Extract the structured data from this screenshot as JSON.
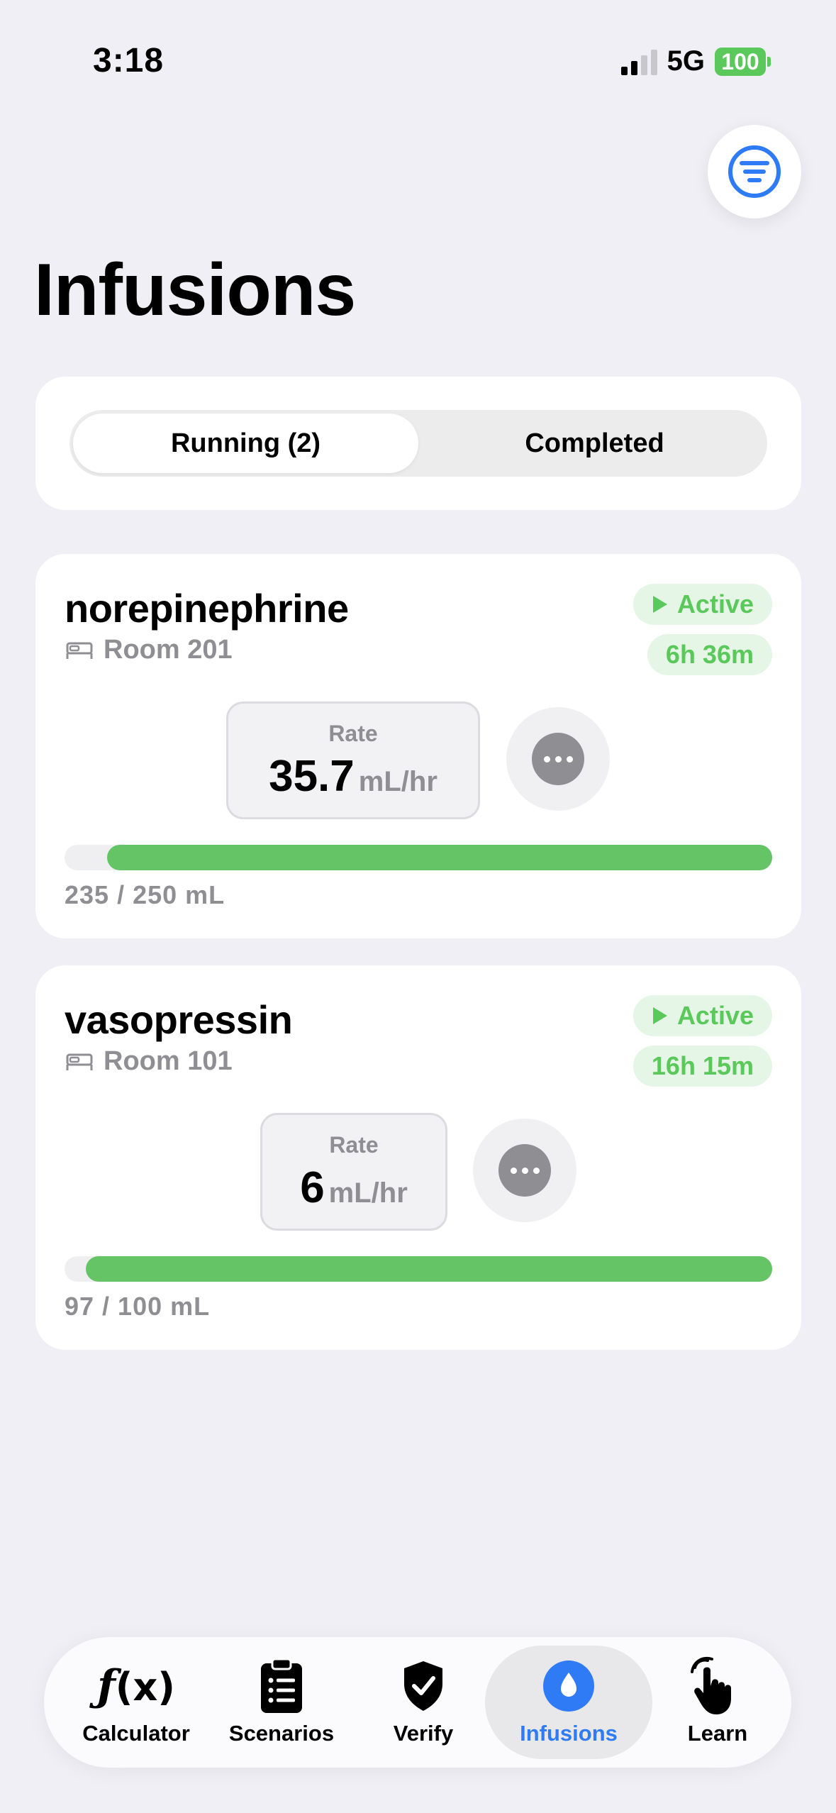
{
  "status_bar": {
    "time": "3:18",
    "network": "5G",
    "battery": "100"
  },
  "page": {
    "title": "Infusions"
  },
  "segments": {
    "running": "Running (2)",
    "completed": "Completed"
  },
  "infusions": [
    {
      "drug": "norepinephrine",
      "room": "Room 201",
      "status": "Active",
      "elapsed": "6h 36m",
      "rate_label": "Rate",
      "rate_value": "35.7",
      "rate_unit": "mL/hr",
      "volume_text": "235 / 250 mL",
      "progress": 0.94
    },
    {
      "drug": "vasopressin",
      "room": "Room 101",
      "status": "Active",
      "elapsed": "16h 15m",
      "rate_label": "Rate",
      "rate_value": "6",
      "rate_unit": "mL/hr",
      "volume_text": "97 / 100 mL",
      "progress": 0.97
    }
  ],
  "tabs": [
    {
      "label": "Calculator",
      "icon": "function-icon"
    },
    {
      "label": "Scenarios",
      "icon": "clipboard-icon"
    },
    {
      "label": "Verify",
      "icon": "shield-check-icon"
    },
    {
      "label": "Infusions",
      "icon": "drop-icon",
      "selected": true
    },
    {
      "label": "Learn",
      "icon": "hand-point-icon"
    }
  ],
  "colors": {
    "accent": "#2f7af5",
    "active_green": "#5ac85a",
    "progress_green": "#65c466"
  }
}
